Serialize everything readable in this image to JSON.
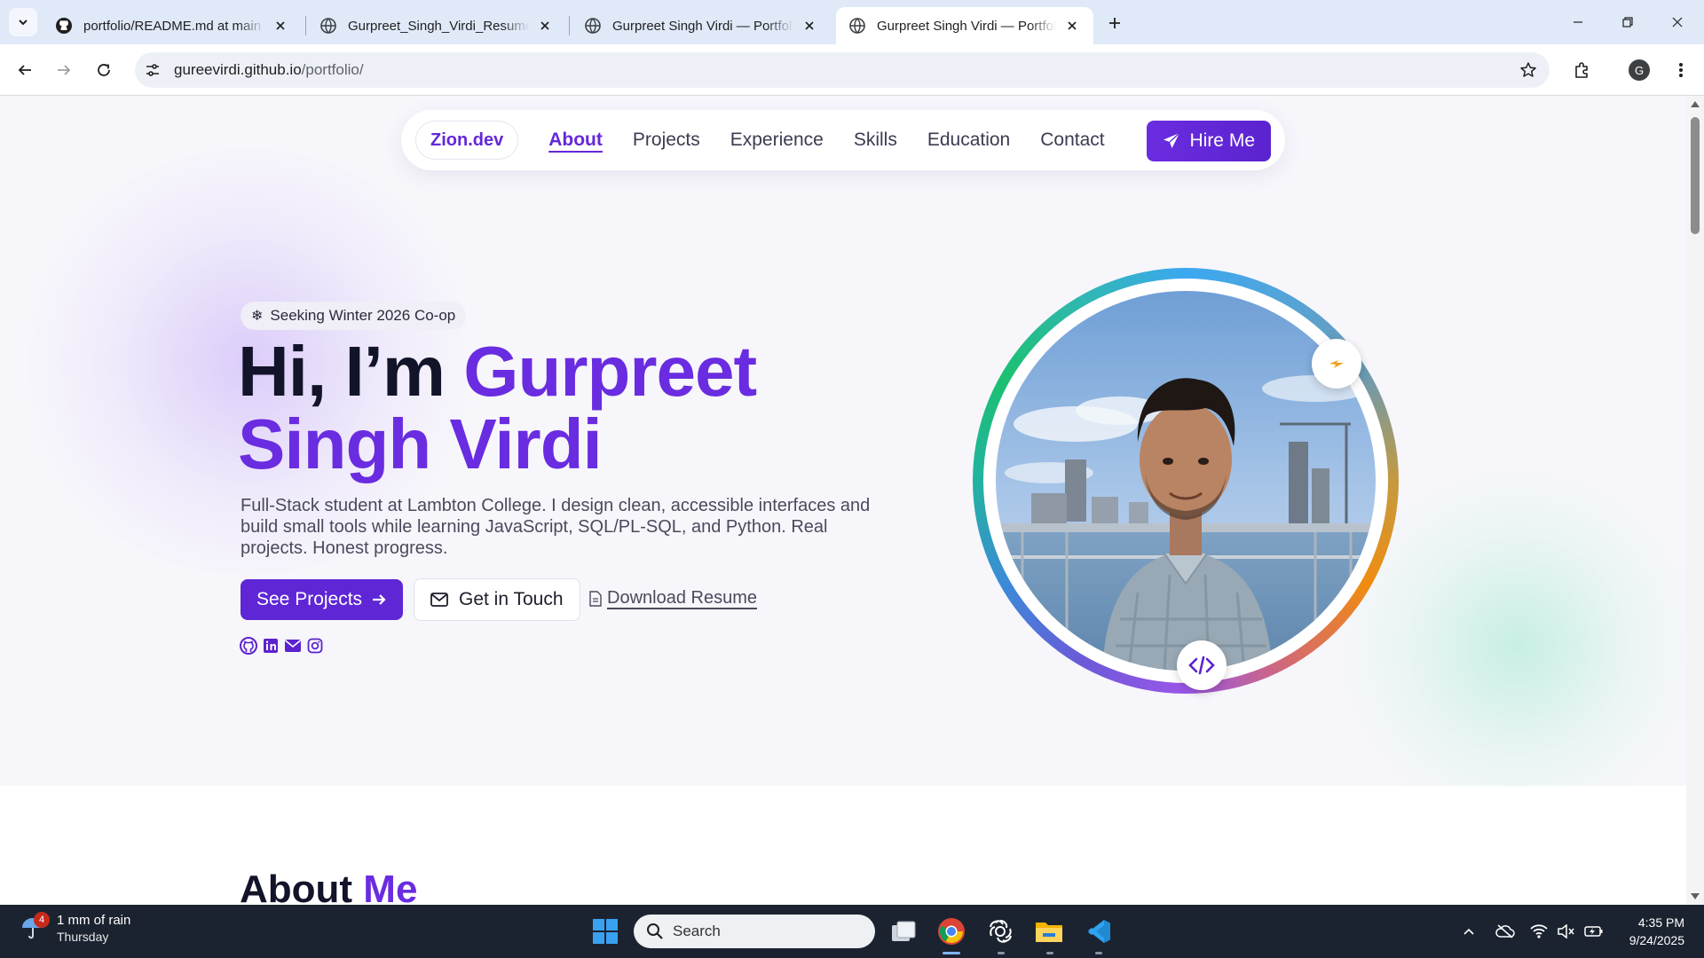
{
  "browser": {
    "tabs": [
      {
        "title": "portfolio/README.md at main · ",
        "favicon": "github-icon"
      },
      {
        "title": "Gurpreet_Singh_Virdi_Resume.pdf",
        "favicon": "globe-icon"
      },
      {
        "title": "Gurpreet Singh Virdi — Portfolio",
        "favicon": "globe-icon"
      },
      {
        "title": "Gurpreet Singh Virdi — Portfolio",
        "favicon": "globe-icon",
        "active": true
      }
    ],
    "url_host": "gureevirdi.github.io",
    "url_path": "/portfolio/",
    "profile_initial": "G"
  },
  "site": {
    "brand": "Zion.dev",
    "nav": [
      "About",
      "Projects",
      "Experience",
      "Skills",
      "Education",
      "Contact"
    ],
    "hire_label": "Hire Me",
    "badge": "Seeking Winter 2026 Co-op",
    "headline_pre": "Hi, I’m ",
    "headline_name1": "Gurpreet",
    "headline_name2": "Singh Virdi",
    "lead": "Full-Stack student at Lambton College. I design clean, accessible interfaces and build small tools while learning JavaScript, SQL/PL-SQL, and Python. Real projects. Honest progress.",
    "btn_projects": "See Projects",
    "btn_contact": "Get in Touch",
    "btn_resume": "Download Resume",
    "socials": [
      "github-icon",
      "linkedin-icon",
      "mail-icon",
      "instagram-icon"
    ],
    "about_pre": "About ",
    "about_accent": "Me",
    "accent_color": "#6a2ce0"
  },
  "taskbar": {
    "weather_line1": "1 mm of rain",
    "weather_line2": "Thursday",
    "weather_badge": "4",
    "search_placeholder": "Search",
    "time": "4:35 PM",
    "date": "9/24/2025"
  }
}
